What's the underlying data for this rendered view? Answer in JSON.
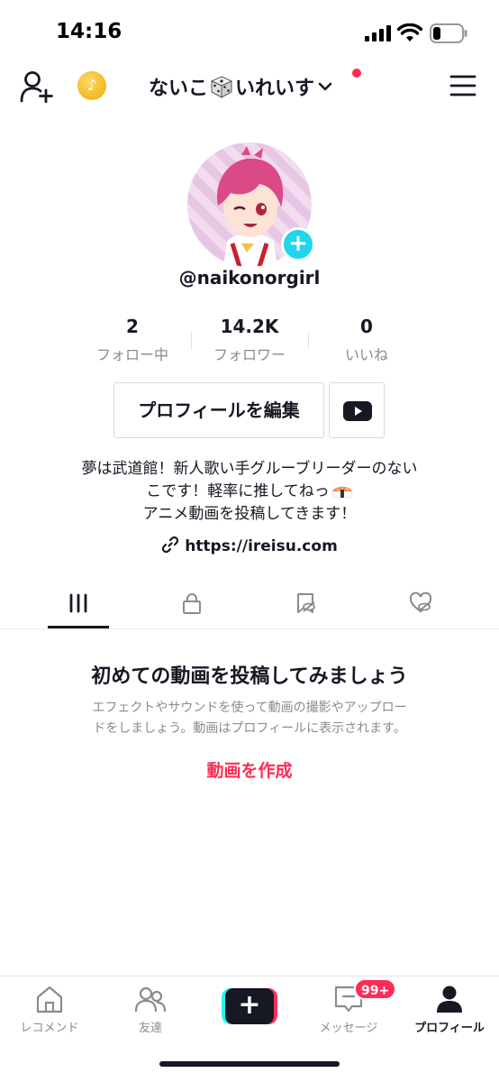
{
  "status_bar": {
    "time": "14:16"
  },
  "header": {
    "account_name_prefix": "ないこ",
    "account_name_suffix": "いれいす",
    "coin_symbol": "♪"
  },
  "profile": {
    "username": "@naikonorgirl",
    "avatar_add_symbol": "+"
  },
  "stats": [
    {
      "value": "2",
      "label": "フォロー中"
    },
    {
      "value": "14.2K",
      "label": "フォロワー"
    },
    {
      "value": "0",
      "label": "いいね"
    }
  ],
  "actions": {
    "edit_profile_label": "プロフィールを編集"
  },
  "bio": {
    "line1": "夢は武道館！新人歌い手グルーブリーダーのない",
    "line2": "こです！軽率に推してねっ",
    "line3": "アニメ動画を投稿してきます！"
  },
  "link": {
    "url": "https://ireisu.com"
  },
  "tabs": [
    {
      "icon": "grid-icon",
      "active": true
    },
    {
      "icon": "lock-icon",
      "active": false
    },
    {
      "icon": "bookmark-hidden-icon",
      "active": false
    },
    {
      "icon": "heart-hidden-icon",
      "active": false
    }
  ],
  "empty_state": {
    "title": "初めての動画を投稿してみましょう",
    "desc_line1": "エフェクトやサウンドを使って動画の撮影やアップロー",
    "desc_line2": "ドをしましょう。動画はプロフィールに表示されます。",
    "cta": "動画を作成"
  },
  "bottom_nav": {
    "items": [
      {
        "label": "レコメンド",
        "icon": "home-icon"
      },
      {
        "label": "友達",
        "icon": "friends-icon"
      },
      {
        "label": "",
        "icon": "create-icon"
      },
      {
        "label": "メッセージ",
        "icon": "inbox-icon"
      },
      {
        "label": "プロフィール",
        "icon": "profile-icon"
      }
    ],
    "create_symbol": "+",
    "inbox_badge": "99+"
  },
  "colors": {
    "accent": "#fe2c55",
    "cyan": "#25f4ee",
    "text": "#161823",
    "muted": "#8a8b91"
  }
}
